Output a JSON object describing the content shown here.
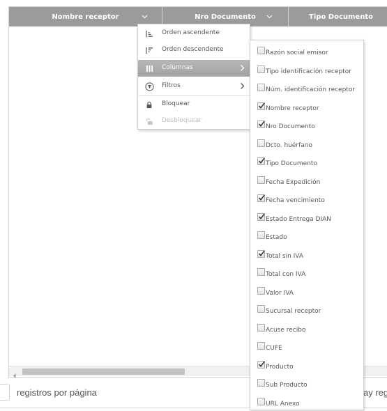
{
  "grid": {
    "columns": [
      {
        "label": "Nombre receptor",
        "menu_icon": "chevron-down-icon"
      },
      {
        "label": "Nro Documento",
        "menu_icon": "chevron-down-icon"
      },
      {
        "label": "Tipo Documento"
      }
    ]
  },
  "column_menu": {
    "items": [
      {
        "label": "Orden ascendente",
        "icon": "sort-ascending-icon",
        "state": "normal"
      },
      {
        "label": "Orden descendente",
        "icon": "sort-descending-icon",
        "state": "normal"
      },
      {
        "label": "Columnas",
        "icon": "columns-icon",
        "state": "active",
        "has_submenu": true
      },
      {
        "label": "Filtros",
        "icon": "filter-icon",
        "state": "normal",
        "has_submenu": true
      },
      {
        "label": "Bloquear",
        "icon": "lock-icon",
        "state": "normal"
      },
      {
        "label": "Desbloquear",
        "icon": "unlock-icon",
        "state": "disabled"
      }
    ]
  },
  "columns_submenu": {
    "items": [
      {
        "label": "Razón social emisor",
        "checked": false
      },
      {
        "label": "Tipo identificación receptor",
        "checked": false
      },
      {
        "label": "Núm. identificación receptor",
        "checked": false
      },
      {
        "label": "Nombre receptor",
        "checked": true
      },
      {
        "label": "Nro Documento",
        "checked": true
      },
      {
        "label": "Dcto. huérfano",
        "checked": false
      },
      {
        "label": "Tipo Documento",
        "checked": true
      },
      {
        "label": "Fecha Expedición",
        "checked": false
      },
      {
        "label": "Fecha vencimiento",
        "checked": true
      },
      {
        "label": "Estado Entrega DIAN",
        "checked": true
      },
      {
        "label": "Estado",
        "checked": false
      },
      {
        "label": "Total sin IVA",
        "checked": true
      },
      {
        "label": "Total con IVA",
        "checked": false
      },
      {
        "label": "Valor IVA",
        "checked": false
      },
      {
        "label": "Sucursal receptor",
        "checked": false
      },
      {
        "label": "Acuse recibo",
        "checked": false
      },
      {
        "label": "CUFE",
        "checked": false
      },
      {
        "label": "Producto",
        "checked": true
      },
      {
        "label": "Sub Producto",
        "checked": false
      },
      {
        "label": "URL Anexo",
        "checked": false
      }
    ]
  },
  "footer": {
    "per_page_label": "registros por página",
    "right_text_partial": "ay reg"
  },
  "colors": {
    "header_bg": "#9b9b9b",
    "active_item_bg": "#a9a9a9",
    "text": "#555555",
    "disabled_text": "#bdbdbd"
  }
}
